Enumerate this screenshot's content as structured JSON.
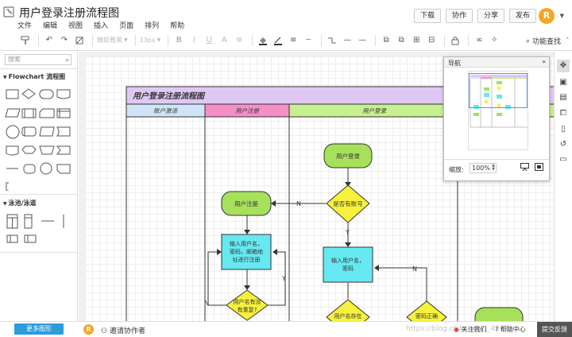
{
  "app": {
    "title": "用户登录注册流程图",
    "menu": [
      "文件",
      "编辑",
      "视图",
      "插入",
      "页面",
      "排列",
      "帮助"
    ],
    "actions": [
      "下载",
      "协作",
      "分享",
      "发布"
    ],
    "avatar_letter": "R"
  },
  "toolbar": {
    "font_family": "微软雅黑",
    "font_size": "13px",
    "function_search": "功能查找"
  },
  "sidebar": {
    "search_placeholder": "搜索",
    "section_flowchart": "Flowchart 流程图",
    "section_swimlane": "泳池/泳道",
    "more_shapes": "更多图形"
  },
  "diagram": {
    "title": "用户登录注册流程图",
    "lanes": [
      "账户激活",
      "用户注册",
      "用户登录"
    ],
    "nodes": {
      "login": "用户登录",
      "has_account": "是否有账号",
      "register": "用户注册",
      "reg_input_1": "输入用户名，",
      "reg_input_2": "密码，邮箱地",
      "reg_input_3": "址进行注册",
      "dup_1": "用户名有没",
      "dup_2": "有重复?",
      "login_input_1": "输入用户名，",
      "login_input_2": "密码",
      "bottom_left": "用户名存在",
      "bottom_mid": "密码正确"
    },
    "edge_labels": {
      "n": "N",
      "y": "Y"
    }
  },
  "navigator": {
    "title": "导航",
    "zoom_label": "缩放:",
    "zoom_value": "100%"
  },
  "bottombar": {
    "avatar_letter": "R",
    "invite": "邀请协作者",
    "follow": "关注我们",
    "help": "帮助中心",
    "feedback": "提交反馈",
    "watermark": "https://blog.csdn.net/q_42771"
  },
  "colors": {
    "title_band": "#e0c8f5",
    "lane_activate": "#cfe5f7",
    "lane_register": "#f48fc7",
    "lane_login": "#c6ef8f",
    "terminator": "#a7e05a",
    "decision": "#f7f13b",
    "process": "#66e8f0",
    "accent": "#2d9cdb"
  }
}
